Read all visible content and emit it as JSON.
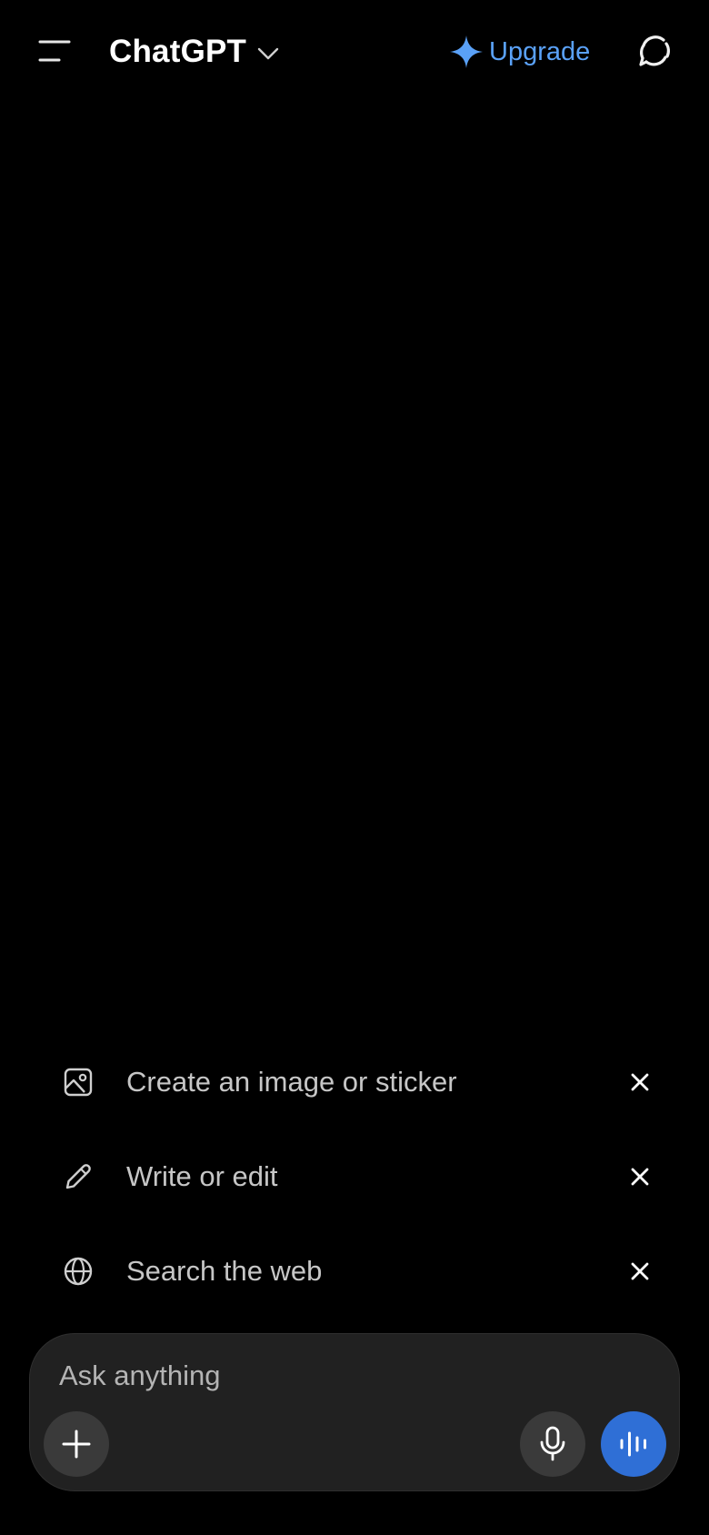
{
  "header": {
    "title": "ChatGPT",
    "upgrade_label": "Upgrade"
  },
  "suggestions": [
    {
      "label": "Create an image or sticker",
      "icon": "image-icon"
    },
    {
      "label": "Write or edit",
      "icon": "pencil-icon"
    },
    {
      "label": "Search the web",
      "icon": "globe-icon"
    }
  ],
  "composer": {
    "placeholder": "Ask anything"
  },
  "colors": {
    "background": "#000000",
    "accent": "#5aa1f7",
    "voice_button": "#2f6fd6",
    "composer_bg": "#212121",
    "suggestion_text": "#c6c6c6"
  }
}
